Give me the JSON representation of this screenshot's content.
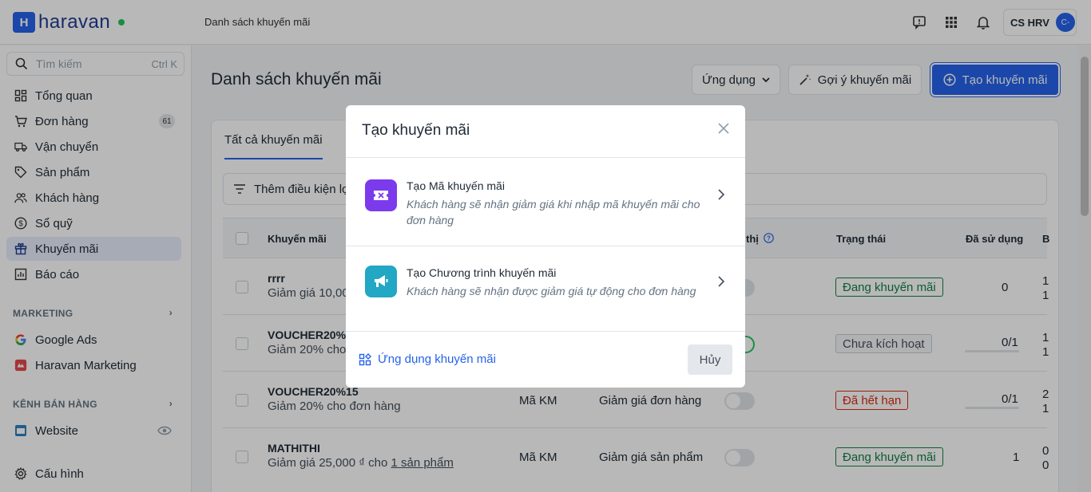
{
  "brand": {
    "name": "haravan"
  },
  "topbar": {
    "breadcrumb": "Danh sách khuyến mãi",
    "user_name": "CS HRV",
    "user_initials": "C-"
  },
  "sidebar": {
    "search_placeholder": "Tìm kiếm",
    "search_shortcut": "Ctrl K",
    "items": [
      {
        "label": "Tổng quan",
        "icon": "dashboard-icon"
      },
      {
        "label": "Đơn hàng",
        "icon": "cart-icon",
        "badge": "61"
      },
      {
        "label": "Vận chuyển",
        "icon": "truck-icon"
      },
      {
        "label": "Sản phẩm",
        "icon": "tag-icon"
      },
      {
        "label": "Khách hàng",
        "icon": "users-icon"
      },
      {
        "label": "Sổ quỹ",
        "icon": "dollar-icon"
      },
      {
        "label": "Khuyến mãi",
        "icon": "gift-icon",
        "active": true
      },
      {
        "label": "Báo cáo",
        "icon": "chart-icon"
      }
    ],
    "marketing_title": "MARKETING",
    "marketing_items": [
      {
        "label": "Google Ads",
        "icon": "google-icon"
      },
      {
        "label": "Haravan Marketing",
        "icon": "haravan-marketing-icon"
      }
    ],
    "channels_title": "KÊNH BÁN HÀNG",
    "channel_items": [
      {
        "label": "Website",
        "icon": "website-icon"
      }
    ],
    "settings_label": "Cấu hình"
  },
  "main": {
    "title": "Danh sách khuyến mãi",
    "apps_button": "Ứng dụng",
    "suggest_button": "Gợi ý khuyến mãi",
    "create_button": "Tạo khuyến mãi",
    "tab_all": "Tất cả khuyến mãi",
    "filter_label": "Thêm điều kiện lọc",
    "columns": {
      "name": "Khuyến mãi",
      "display": "thị",
      "status": "Trạng thái",
      "used": "Đã sử dụng",
      "extra": "B"
    },
    "rows": [
      {
        "name": "rrrr",
        "desc": "Giảm giá 10,00",
        "status": "Đang khuyến mãi",
        "used": "0",
        "extra1": "1",
        "extra2": "1"
      },
      {
        "name": "VOUCHER20%",
        "desc": "Giảm 20% cho",
        "status": "Chưa kích hoạt",
        "used": "0/1",
        "extra1": "1",
        "extra2": "1"
      },
      {
        "name": "VOUCHER20%15",
        "desc": "Giảm 20% cho đơn hàng",
        "type": "Mã KM",
        "kind": "Giảm giá đơn hàng",
        "status": "Đã hết hạn",
        "used": "0/1",
        "extra1": "2",
        "extra2": "1"
      },
      {
        "name": "MATHITHI",
        "desc": "Giảm giá 25,000 ₫ cho",
        "desc_link": "1 sản phẩm",
        "type": "Mã KM",
        "kind": "Giảm giá sản phẩm",
        "status": "Đang khuyến mãi",
        "used": "1",
        "extra1": "0",
        "extra2": "0"
      }
    ]
  },
  "modal": {
    "title": "Tạo khuyến mãi",
    "option1_title": "Tạo Mã khuyến mãi",
    "option1_desc": "Khách hàng sẽ nhận giảm giá khi nhập mã khuyến mãi cho đơn hàng",
    "option2_title": "Tạo Chương trình khuyến mãi",
    "option2_desc": "Khách hàng sẽ nhận được giảm giá tự động cho đơn hàng",
    "apps_link": "Ứng dụng khuyến mãi",
    "cancel": "Hủy"
  },
  "colors": {
    "primary": "#2463eb",
    "option1_icon": "#7c3aed",
    "option2_icon": "#22a7c4"
  }
}
